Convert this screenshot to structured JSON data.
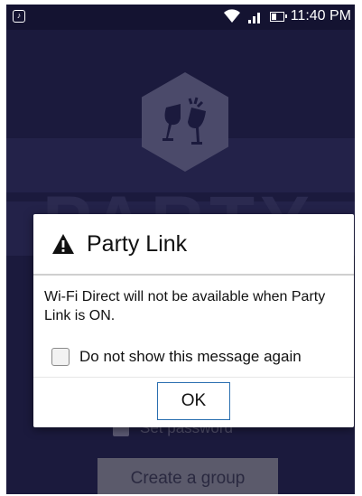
{
  "status_bar": {
    "time": "11:40 PM",
    "left_icon": "notification-icon",
    "icons": [
      "wifi-icon",
      "signal-icon",
      "battery-icon"
    ]
  },
  "background": {
    "logo_icon": "toast-glasses-icon",
    "app_word": "PARTY",
    "checkbox_label": "Set password",
    "button_label": "Create a group"
  },
  "dialog": {
    "title_icon": "warning-icon",
    "title": "Party Link",
    "message": "Wi-Fi Direct will not be available when Party Link is ON.",
    "checkbox_label": "Do not show this message again",
    "checkbox_checked": false,
    "ok_label": "OK"
  },
  "colors": {
    "backdrop": "#1b1a3d",
    "button_border": "#2a6fb0"
  }
}
